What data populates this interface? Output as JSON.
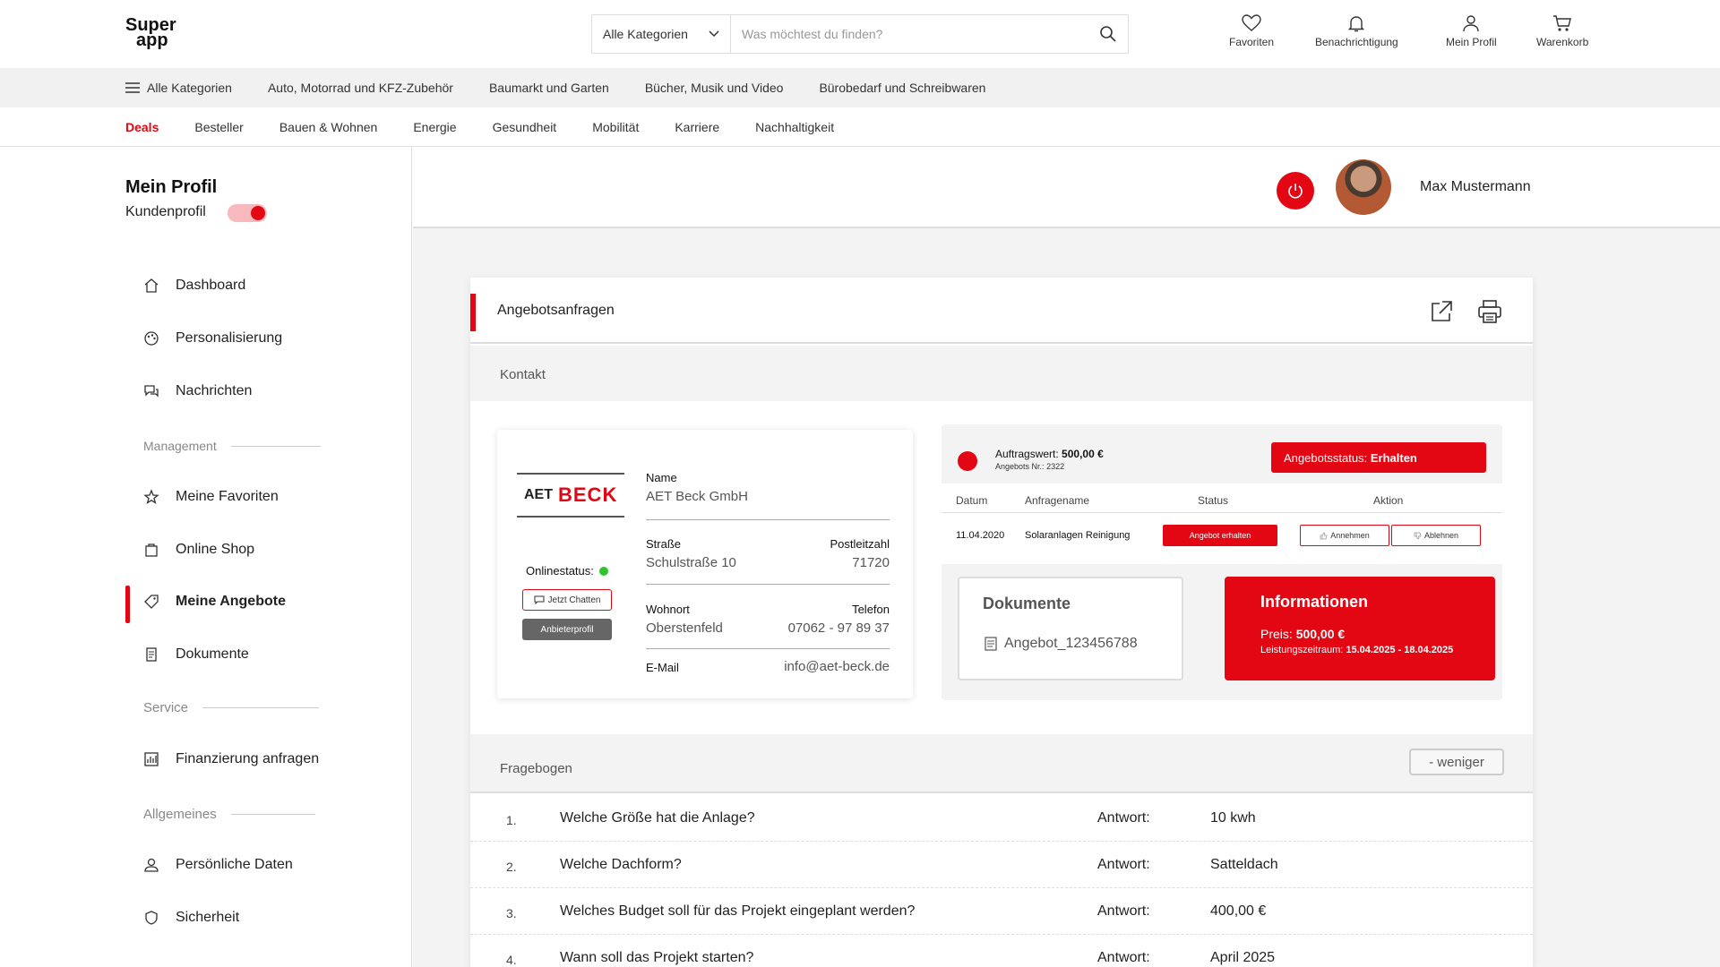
{
  "brand": {
    "logo_line1": "Super",
    "logo_line2": "app",
    "accent": "#e30613"
  },
  "search": {
    "category": "Alle Kategorien",
    "placeholder": "Was möchtest du finden?"
  },
  "header_icons": [
    {
      "label": "Favoriten",
      "icon": "heart-icon"
    },
    {
      "label": "Benachrichtigung",
      "icon": "bell-icon"
    },
    {
      "label": "Mein Profil",
      "icon": "user-icon"
    },
    {
      "label": "Warenkorb",
      "icon": "cart-icon"
    }
  ],
  "categories": [
    "Alle Kategorien",
    "Auto, Motorrad und KFZ-Zubehör",
    "Baumarkt und Garten",
    "Bücher, Musik und Video",
    "Bürobedarf und Schreibwaren"
  ],
  "subnav": [
    "Deals",
    "Besteller",
    "Bauen & Wohnen",
    "Energie",
    "Gesundheit",
    "Mobilität",
    "Karriere",
    "Nachhaltigkeit"
  ],
  "sidebar": {
    "title": "Mein Profil",
    "subtitle": "Kundenprofil",
    "items": [
      {
        "label": "Dashboard",
        "icon": "home-icon"
      },
      {
        "label": "Personalisierung",
        "icon": "palette-icon"
      },
      {
        "label": "Nachrichten",
        "icon": "message-icon"
      },
      {
        "label": "Meine Favoriten",
        "icon": "star-icon"
      },
      {
        "label": "Online Shop",
        "icon": "shop-icon"
      },
      {
        "label": "Meine Angebote",
        "icon": "tag-icon"
      },
      {
        "label": "Dokumente",
        "icon": "document-icon"
      },
      {
        "label": "Finanzierung anfragen",
        "icon": "chart-icon"
      },
      {
        "label": "Persönliche Daten",
        "icon": "user-icon"
      },
      {
        "label": "Sicherheit",
        "icon": "shield-icon"
      }
    ],
    "groups": [
      "Management",
      "Service",
      "Allgemeines"
    ]
  },
  "user": {
    "name": "Max Mustermann"
  },
  "card": {
    "title": "Angebotsanfragen",
    "section_contact": "Kontakt"
  },
  "company": {
    "logo_text_1": "AET",
    "logo_text_2": "BECK",
    "onlinestatus_label": "Onlinestatus:",
    "chat_label": "Jetzt Chatten",
    "profile_label": "Anbieterprofil",
    "name_label": "Name",
    "name": "AET Beck GmbH",
    "street_label": "Straße",
    "street": "Schulstraße 10",
    "zip_label": "Postleitzahl",
    "zip": "71720",
    "city_label": "Wohnort",
    "city": "Oberstenfeld",
    "phone_label": "Telefon",
    "phone": "07062 - 97 89 37",
    "email_label": "E-Mail",
    "email": "info@aet-beck.de"
  },
  "offer": {
    "order_value_label": "Auftragswert:",
    "order_value": "500,00 €",
    "offer_no_label": "Angebots Nr.:",
    "offer_no": "2322",
    "status_label": "Angebotsstatus:",
    "status_value": "Erhalten",
    "columns": [
      "Datum",
      "Anfragename",
      "Status",
      "Aktion"
    ],
    "row": {
      "date": "11.04.2020",
      "name": "Solaranlagen Reinigung",
      "status": "Angebot erhalten",
      "accept": "Annehmen",
      "reject": "Ablehnen"
    },
    "docs_title": "Dokumente",
    "doc_name": "Angebot_123456788",
    "info_title": "Informationen",
    "price_label": "Preis:",
    "price": "500,00 €",
    "period_label": "Leistungszeitraum:",
    "period": "15.04.2025 - 18.04.2025"
  },
  "questionnaire": {
    "title": "Fragebogen",
    "less_label": "- weniger",
    "answer_label": "Antwort:",
    "rows": [
      {
        "n": "1.",
        "q": "Welche Größe hat die Anlage?",
        "a": "10 kwh"
      },
      {
        "n": "2.",
        "q": "Welche Dachform?",
        "a": "Satteldach"
      },
      {
        "n": "3.",
        "q": "Welches Budget soll für das Projekt eingeplant werden?",
        "a": "400,00 €"
      },
      {
        "n": "4.",
        "q": "Wann soll das Projekt starten?",
        "a": "April 2025"
      }
    ]
  }
}
